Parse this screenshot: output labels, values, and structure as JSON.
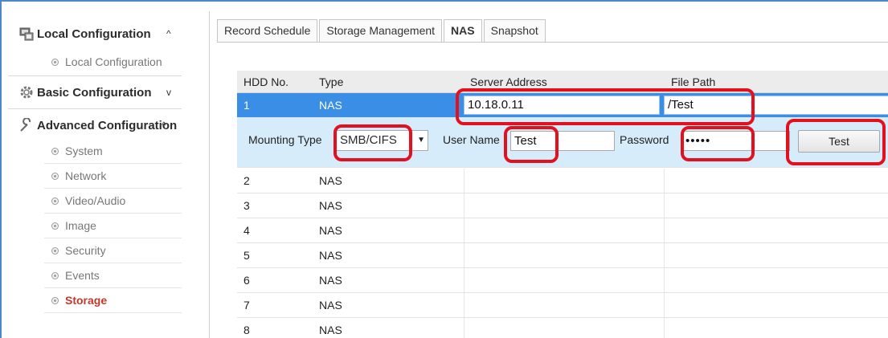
{
  "colors": {
    "accent": "#3a8ee6",
    "annotation": "#e3101e",
    "active_item": "#c0392b",
    "detail_bg": "#d6ecfb"
  },
  "sidebar": {
    "sections": [
      {
        "label": "Local Configuration",
        "icon": "local-config-icon",
        "chevron": "^"
      },
      {
        "label": "Basic Configuration",
        "icon": "basic-config-icon",
        "chevron": "v"
      },
      {
        "label": "Advanced Configuration",
        "icon": "wrench-icon",
        "chevron": "^"
      }
    ],
    "local_items": [
      "Local Configuration"
    ],
    "advanced_items": [
      "System",
      "Network",
      "Video/Audio",
      "Image",
      "Security",
      "Events",
      "Storage"
    ],
    "active_item": "Storage"
  },
  "tabs": [
    "Record Schedule",
    "Storage Management",
    "NAS",
    "Snapshot"
  ],
  "active_tab": "NAS",
  "table": {
    "headers": {
      "hdd_no": "HDD No.",
      "type": "Type",
      "server_address": "Server Address",
      "file_path": "File Path"
    },
    "selected_row": {
      "hdd_no": "1",
      "type": "NAS",
      "server_address": "10.18.0.11",
      "file_path": "/Test"
    },
    "detail": {
      "mounting_type_label": "Mounting Type",
      "mounting_type_value": "SMB/CIFS",
      "user_name_label": "User Name",
      "user_name_value": "Test",
      "password_label": "Password",
      "password_value": "•••••",
      "test_button": "Test"
    },
    "rows": [
      {
        "hdd_no": "2",
        "type": "NAS"
      },
      {
        "hdd_no": "3",
        "type": "NAS"
      },
      {
        "hdd_no": "4",
        "type": "NAS"
      },
      {
        "hdd_no": "5",
        "type": "NAS"
      },
      {
        "hdd_no": "6",
        "type": "NAS"
      },
      {
        "hdd_no": "7",
        "type": "NAS"
      },
      {
        "hdd_no": "8",
        "type": "NAS"
      }
    ]
  }
}
